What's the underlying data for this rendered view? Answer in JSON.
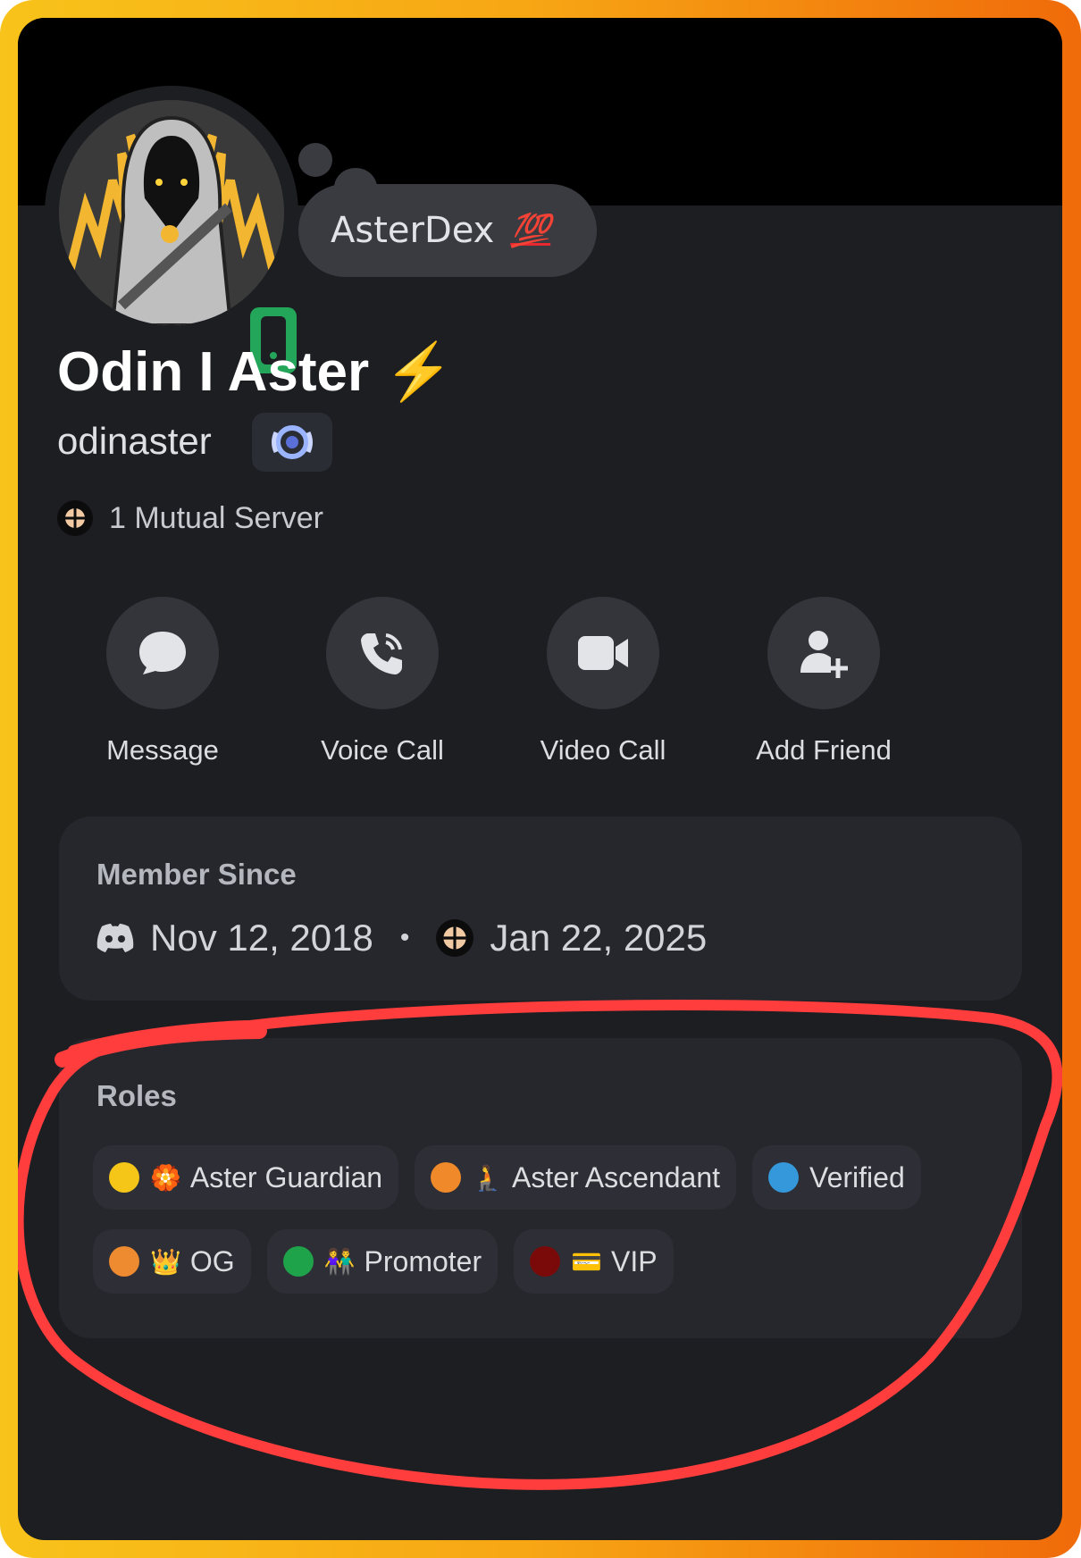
{
  "profile": {
    "banner_color": "#000000",
    "status_icon": "mobile-phone-icon",
    "status_color": "#23a55a",
    "custom_status": "AsterDex",
    "custom_status_emoji": "💯",
    "display_name": "Odin I Aster",
    "display_name_emoji": "⚡",
    "username": "odinaster",
    "badge_icon": "laurel-badge-icon",
    "mutual_servers": "1 Mutual Server"
  },
  "actions": [
    {
      "label": "Message",
      "icon": "chat-bubble-icon"
    },
    {
      "label": "Voice Call",
      "icon": "phone-icon"
    },
    {
      "label": "Video Call",
      "icon": "video-camera-icon"
    },
    {
      "label": "Add Friend",
      "icon": "add-friend-icon"
    }
  ],
  "member_since": {
    "title": "Member Since",
    "discord_date": "Nov 12, 2018",
    "separator": "•",
    "server_date": "Jan 22, 2025"
  },
  "roles": {
    "title": "Roles",
    "items": [
      {
        "name": "Aster Guardian",
        "color": "#f5c518",
        "emoji": "🏵️"
      },
      {
        "name": "Aster Ascendant",
        "color": "#f0892a",
        "emoji": "🧎"
      },
      {
        "name": "Verified",
        "color": "#3498db",
        "emoji": ""
      },
      {
        "name": "OG",
        "color": "#ee8a2f",
        "emoji": "👑"
      },
      {
        "name": "Promoter",
        "color": "#1fa34a",
        "emoji": "👫"
      },
      {
        "name": "VIP",
        "color": "#7a0a0a",
        "emoji": "💳"
      }
    ]
  },
  "annotation_color": "#ff3d3d",
  "accent_colors": {
    "frame_start": "#f8c31a",
    "frame_end": "#f06b0a",
    "background": "#1d1e22",
    "card": "#26272d"
  }
}
